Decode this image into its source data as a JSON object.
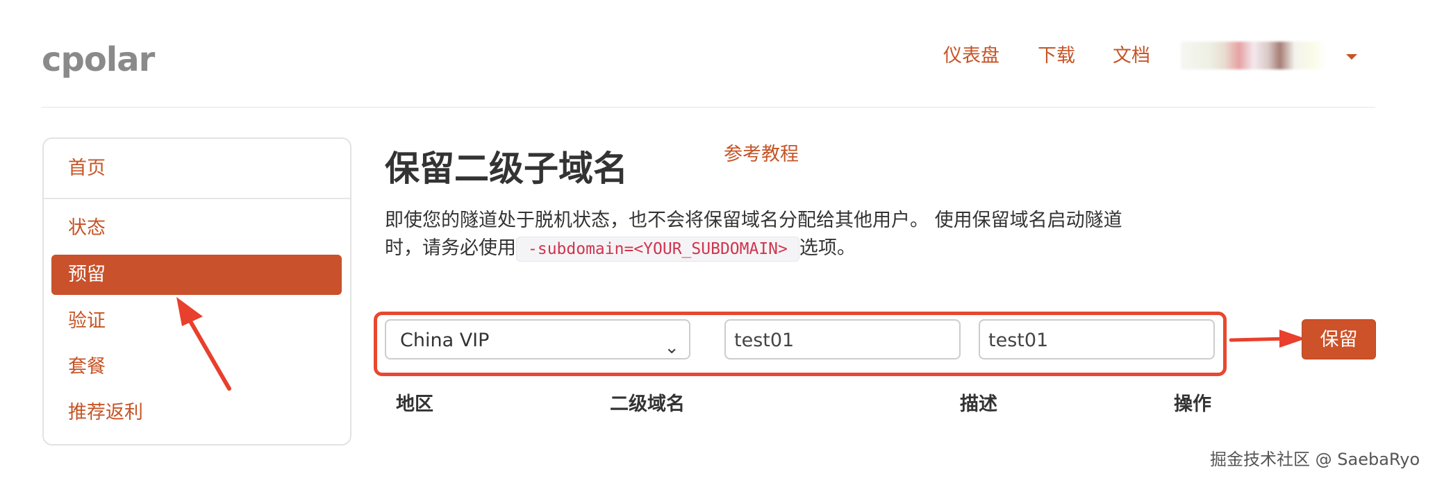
{
  "app": {
    "logo": "cpolar"
  },
  "topnav": {
    "dashboard": "仪表盘",
    "download": "下载",
    "docs": "文档"
  },
  "sidebar": {
    "items": [
      {
        "label": "首页"
      },
      {
        "label": "状态"
      },
      {
        "label": "预留",
        "active": true
      },
      {
        "label": "验证"
      },
      {
        "label": "套餐"
      },
      {
        "label": "推荐返利"
      }
    ]
  },
  "main": {
    "title": "保留二级子域名",
    "ref_link": "参考教程",
    "desc_line1": "即使您的隧道处于脱机状态，也不会将保留域名分配给其他用户。 使用保留域名启动隧道",
    "desc_line2_prefix": "时，请务必使用",
    "desc_code": "-subdomain=<YOUR_SUBDOMAIN>",
    "desc_line2_suffix": "选项。"
  },
  "form": {
    "region_selected": "China VIP",
    "subdomain_value": "test01",
    "description_value": "test01",
    "reserve_button": "保留"
  },
  "table": {
    "headers": [
      "地区",
      "二级域名",
      "描述",
      "操作"
    ]
  },
  "watermark": "掘金技术社区 @ SaebaRyo",
  "colors": {
    "accent": "#c65426",
    "active_bg": "#c9512b",
    "highlight": "#e8482f"
  }
}
